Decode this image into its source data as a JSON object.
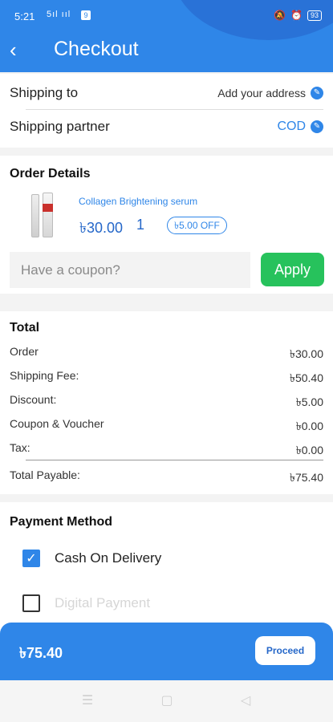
{
  "status_bar": {
    "time": "5:21",
    "signal_text": "5ıl ııl",
    "sim_badge": "9",
    "battery": "93"
  },
  "header": {
    "title": "Checkout",
    "back_icon": "back-arrow-icon"
  },
  "shipping": {
    "to_label": "Shipping to",
    "to_value": "Add your address",
    "partner_label": "Shipping partner",
    "partner_value": "COD",
    "edit_icon": "edit-icon"
  },
  "order": {
    "heading": "Order Details",
    "product": {
      "name": "Collagen Brightening serum",
      "price": "৳30.00",
      "quantity": "1",
      "discount": "৳5.00 OFF"
    },
    "coupon": {
      "placeholder": "Have a coupon?",
      "apply_label": "Apply"
    }
  },
  "total": {
    "heading": "Total",
    "rows": [
      {
        "label": "Order",
        "value": "৳30.00"
      },
      {
        "label": "Shipping Fee:",
        "value": "৳50.40"
      },
      {
        "label": "Discount:",
        "value": "৳5.00"
      },
      {
        "label": "Coupon & Voucher",
        "value": "৳0.00"
      },
      {
        "label": "Tax:",
        "value": "৳0.00"
      }
    ],
    "payable_label": "Total Payable:",
    "payable_value": "৳75.40"
  },
  "payment": {
    "heading": "Payment Method",
    "options": [
      {
        "label": "Cash On Delivery",
        "checked": true
      },
      {
        "label": "Digital Payment",
        "checked": false
      }
    ]
  },
  "footer": {
    "amount": "৳75.40",
    "proceed_label": "Proceed"
  },
  "colors": {
    "primary": "#2f86e8",
    "apply_green": "#27c25c"
  }
}
